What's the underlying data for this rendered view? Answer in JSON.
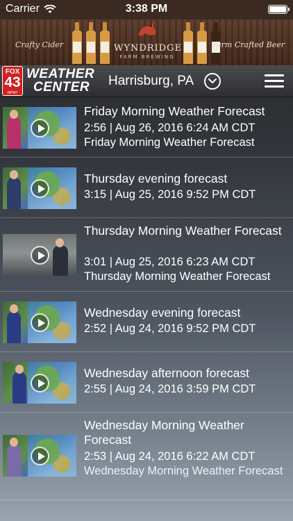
{
  "status_bar": {
    "carrier": "Carrier",
    "time": "3:38 PM"
  },
  "ad": {
    "left_text": "Crafty Cider",
    "brand": "WYNDRIDGE",
    "brand_sub": "FARM BREWING",
    "right_text": "Farm Crafted Beer"
  },
  "header": {
    "logo_fox": "FOX",
    "logo_number": "43",
    "logo_call": "WPMT",
    "logo_line1": "WEATHER",
    "logo_line2": "CENTER",
    "location": "Harrisburg, PA"
  },
  "videos": [
    {
      "title": "Friday Morning Weather Forecast",
      "meta": "2:56 | Aug 26, 2016 6:24 AM CDT",
      "description": "Friday Morning Weather Forecast"
    },
    {
      "title": "Thursday evening forecast",
      "meta": "3:15 | Aug 25, 2016 9:52 PM CDT",
      "description": ""
    },
    {
      "title": "Thursday Morning Weather Forecast",
      "meta": "3:01 | Aug 25, 2016 6:23 AM CDT",
      "description": "Thursday Morning Weather Forecast"
    },
    {
      "title": "Wednesday evening forecast",
      "meta": "2:52 | Aug 24, 2016 9:52 PM CDT",
      "description": ""
    },
    {
      "title": "Wednesday afternoon forecast",
      "meta": "2:55 | Aug 24, 2016 3:59 PM CDT",
      "description": ""
    },
    {
      "title": "Wednesday Morning Weather Forecast",
      "meta": "2:53 | Aug 24, 2016 6:22 AM CDT",
      "description": "Wednesday Morning Weather Forecast"
    }
  ]
}
